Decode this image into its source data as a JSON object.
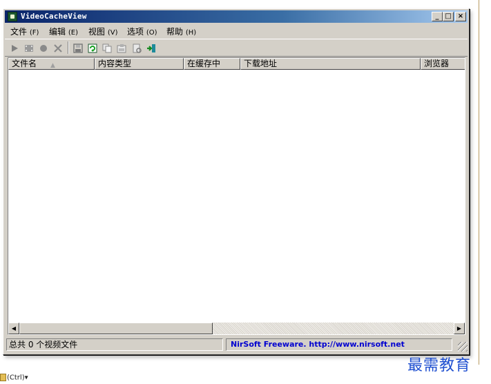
{
  "window": {
    "title": "VideoCacheView",
    "minimize": "_",
    "maximize": "□",
    "close": "×"
  },
  "menu": [
    {
      "label": "文件",
      "accel": "(F)"
    },
    {
      "label": "编辑",
      "accel": "(E)"
    },
    {
      "label": "视图",
      "accel": "(V)"
    },
    {
      "label": "选项",
      "accel": "(O)"
    },
    {
      "label": "帮助",
      "accel": "(H)"
    }
  ],
  "toolbar": {
    "icons": [
      "play-icon",
      "film-icon",
      "record-icon",
      "delete-icon",
      "save-icon",
      "refresh-icon",
      "copy-icon",
      "properties-icon",
      "report-icon",
      "exit-icon"
    ]
  },
  "columns": [
    "文件名",
    "内容类型",
    "在缓存中",
    "下载地址",
    "浏览器"
  ],
  "sort_indicator": "▲",
  "scroll": {
    "left": "◀",
    "right": "▶"
  },
  "status": {
    "count_text": "总共 0 个视频文件",
    "link_text": "NirSoft Freeware.  http://www.nirsoft.net"
  },
  "watermark": "最需教育",
  "ctrl_chip": "(Ctrl)▾",
  "colors": {
    "title_start": "#0a246a",
    "title_end": "#a6caf0",
    "link": "#0000d0",
    "watermark": "#1f4fd0"
  }
}
